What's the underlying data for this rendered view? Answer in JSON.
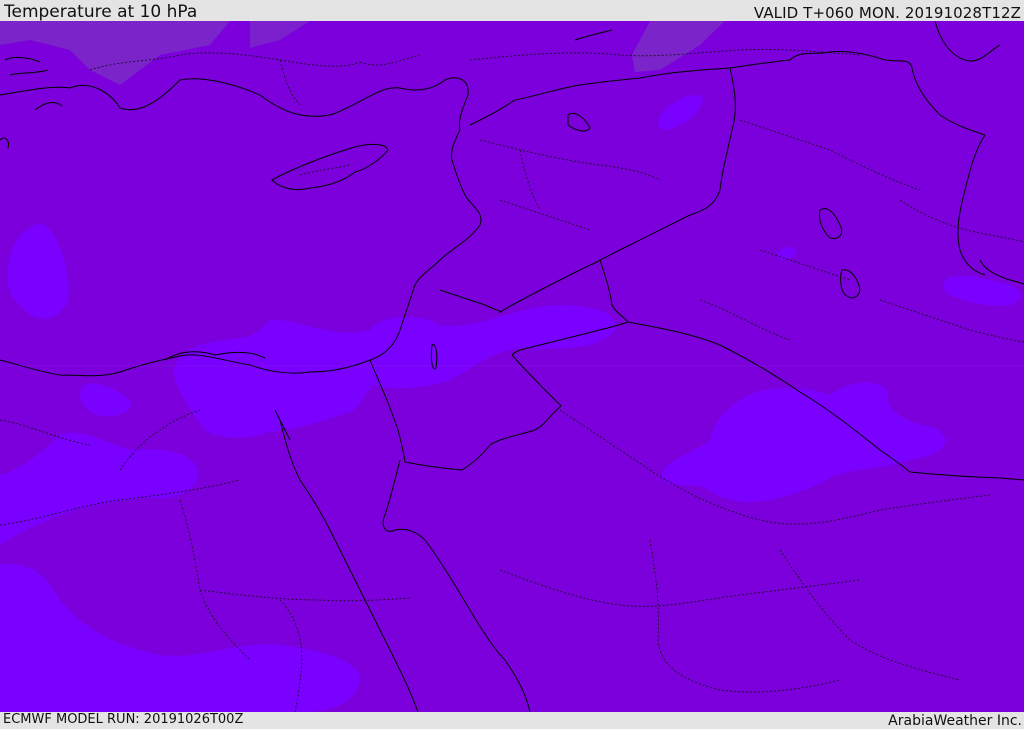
{
  "header": {
    "title": "Temperature at 10 hPa",
    "valid": "VALID T+060 MON. 20191028T12Z"
  },
  "footer": {
    "model_run": "ECMWF MODEL RUN: 20191026T00Z",
    "credit": "ArabiaWeather Inc."
  },
  "map": {
    "variable": "temperature",
    "level": "10 hPa",
    "colors": {
      "base_fill": "#7b00dc",
      "warm_fill": "#7a00ff",
      "cold_fill": "#7a28c8",
      "coastline": "#000000",
      "border": "#000000",
      "inner_border": "#111111"
    }
  }
}
